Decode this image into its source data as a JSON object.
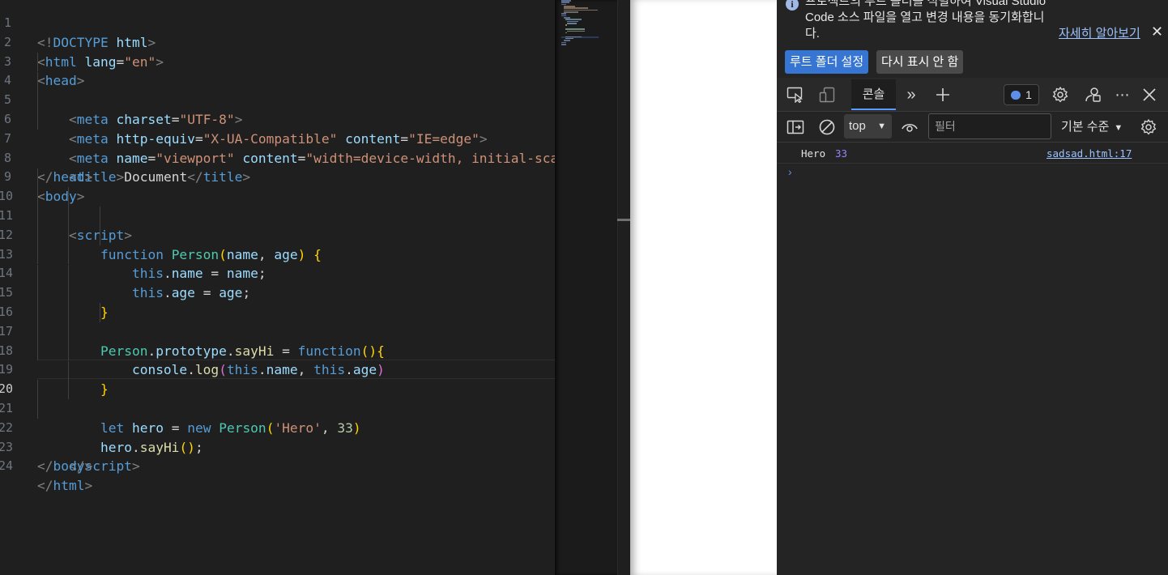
{
  "editor": {
    "active_line": 20,
    "lines": [
      {
        "n": "1"
      },
      {
        "n": "2"
      },
      {
        "n": "3"
      },
      {
        "n": "4"
      },
      {
        "n": "5"
      },
      {
        "n": "6"
      },
      {
        "n": "7"
      },
      {
        "n": "8"
      },
      {
        "n": "9"
      },
      {
        "n": "10"
      },
      {
        "n": "11"
      },
      {
        "n": "12"
      },
      {
        "n": "13"
      },
      {
        "n": "14"
      },
      {
        "n": "15"
      },
      {
        "n": "16"
      },
      {
        "n": "17"
      },
      {
        "n": "18"
      },
      {
        "n": "19"
      },
      {
        "n": "20"
      },
      {
        "n": "21"
      },
      {
        "n": "22"
      },
      {
        "n": "23"
      },
      {
        "n": "24"
      }
    ]
  },
  "devtools": {
    "info": {
      "message": "프로젝트의 루트 폴더를 식별하여 Visual Studio Code 소스 파일을 열고 변경 내용을 동기화합니다.",
      "learn_more": "자세히 알아보기",
      "set_root_button": "루트 폴더 설정",
      "never_show_button": "다시 표시 안 함"
    },
    "tabs": {
      "console": "콘솔"
    },
    "issues_count": "1",
    "filter": {
      "context": "top",
      "placeholder": "필터",
      "levels": "기본 수준"
    },
    "console": {
      "messages": [
        {
          "text": "Hero",
          "number": "33",
          "source": "sadsad.html:17"
        }
      ]
    }
  },
  "colors": {
    "editor_bg": "#1f1f1f",
    "devtools_bg": "#242424",
    "accent": "#3775d3",
    "link": "#9cc3ff",
    "number": "#9980ff"
  }
}
